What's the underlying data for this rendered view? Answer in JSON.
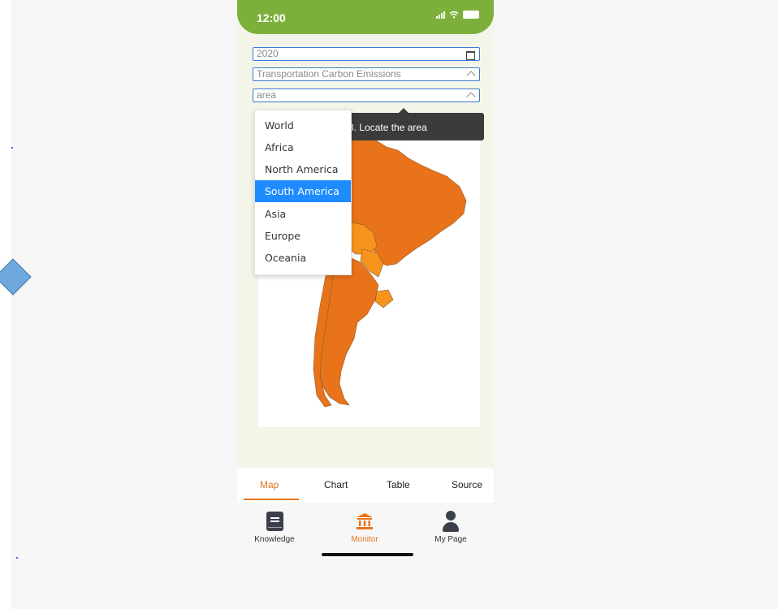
{
  "status_bar": {
    "time": "12:00",
    "icons": [
      "signal-icon",
      "wifi-icon",
      "battery-icon"
    ]
  },
  "filters": {
    "year": {
      "value": "2020",
      "icon": "calendar-icon"
    },
    "indicator": {
      "value": "Transportation Carbon Emissions",
      "icon": "chevron-up-icon"
    },
    "area": {
      "value": "area",
      "icon": "chevron-up-icon"
    }
  },
  "tooltip": {
    "text": "3. Locate the area"
  },
  "dropdown": {
    "options": [
      "World",
      "Africa",
      "North America",
      "South America",
      "Asia",
      "Europe",
      "Oceania"
    ],
    "selected": "South America"
  },
  "map": {
    "region": "South America",
    "colors": {
      "high": "#e8731a",
      "medium": "#f7941d",
      "border": "#8a5a2b"
    }
  },
  "tabs": {
    "items": [
      "Map",
      "Chart",
      "Table",
      "Source"
    ],
    "active": "Map"
  },
  "bottom_nav": {
    "items": [
      {
        "label": "Knowledge",
        "icon": "book-icon"
      },
      {
        "label": "Monitor",
        "icon": "bank-icon"
      },
      {
        "label": "My Page",
        "icon": "person-icon"
      }
    ],
    "active": "Monitor"
  },
  "colors": {
    "accent": "#e8741b",
    "statusbar": "#7db03a",
    "selection": "#1e8cff",
    "field_border": "#3a7bd5"
  }
}
